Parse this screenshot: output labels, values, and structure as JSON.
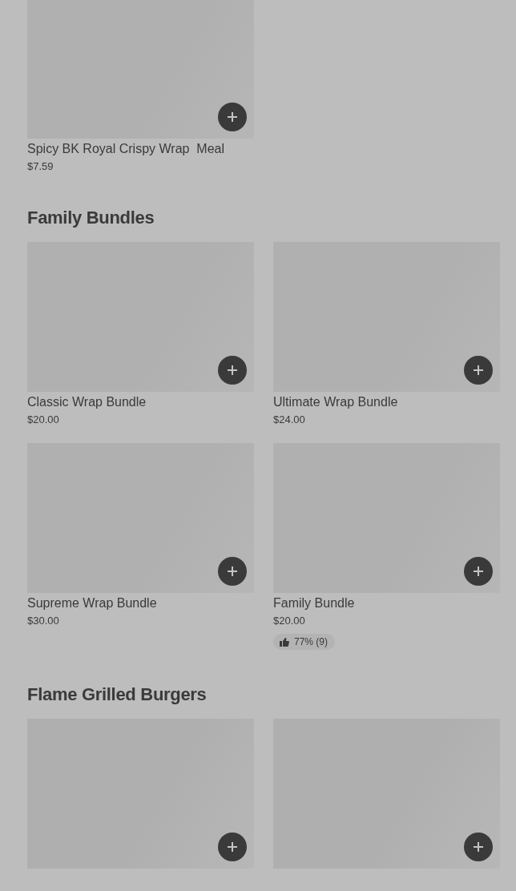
{
  "sections": [
    {
      "items": [
        {
          "kind": "product",
          "name": "Spicy BK Royal Crispy Wrap  Meal",
          "price": "$7.59"
        }
      ]
    },
    {
      "title": "Family Bundles",
      "items": [
        {
          "kind": "product",
          "name": "Classic Wrap Bundle",
          "price": "$20.00"
        },
        {
          "kind": "product",
          "name": "Ultimate Wrap Bundle",
          "price": "$24.00"
        },
        {
          "kind": "product",
          "name": "Supreme Wrap Bundle",
          "price": "$30.00"
        },
        {
          "kind": "product",
          "name": "Family Bundle",
          "price": "$20.00",
          "rating": "77% (9)"
        }
      ]
    },
    {
      "title": "Flame Grilled Burgers"
    }
  ]
}
